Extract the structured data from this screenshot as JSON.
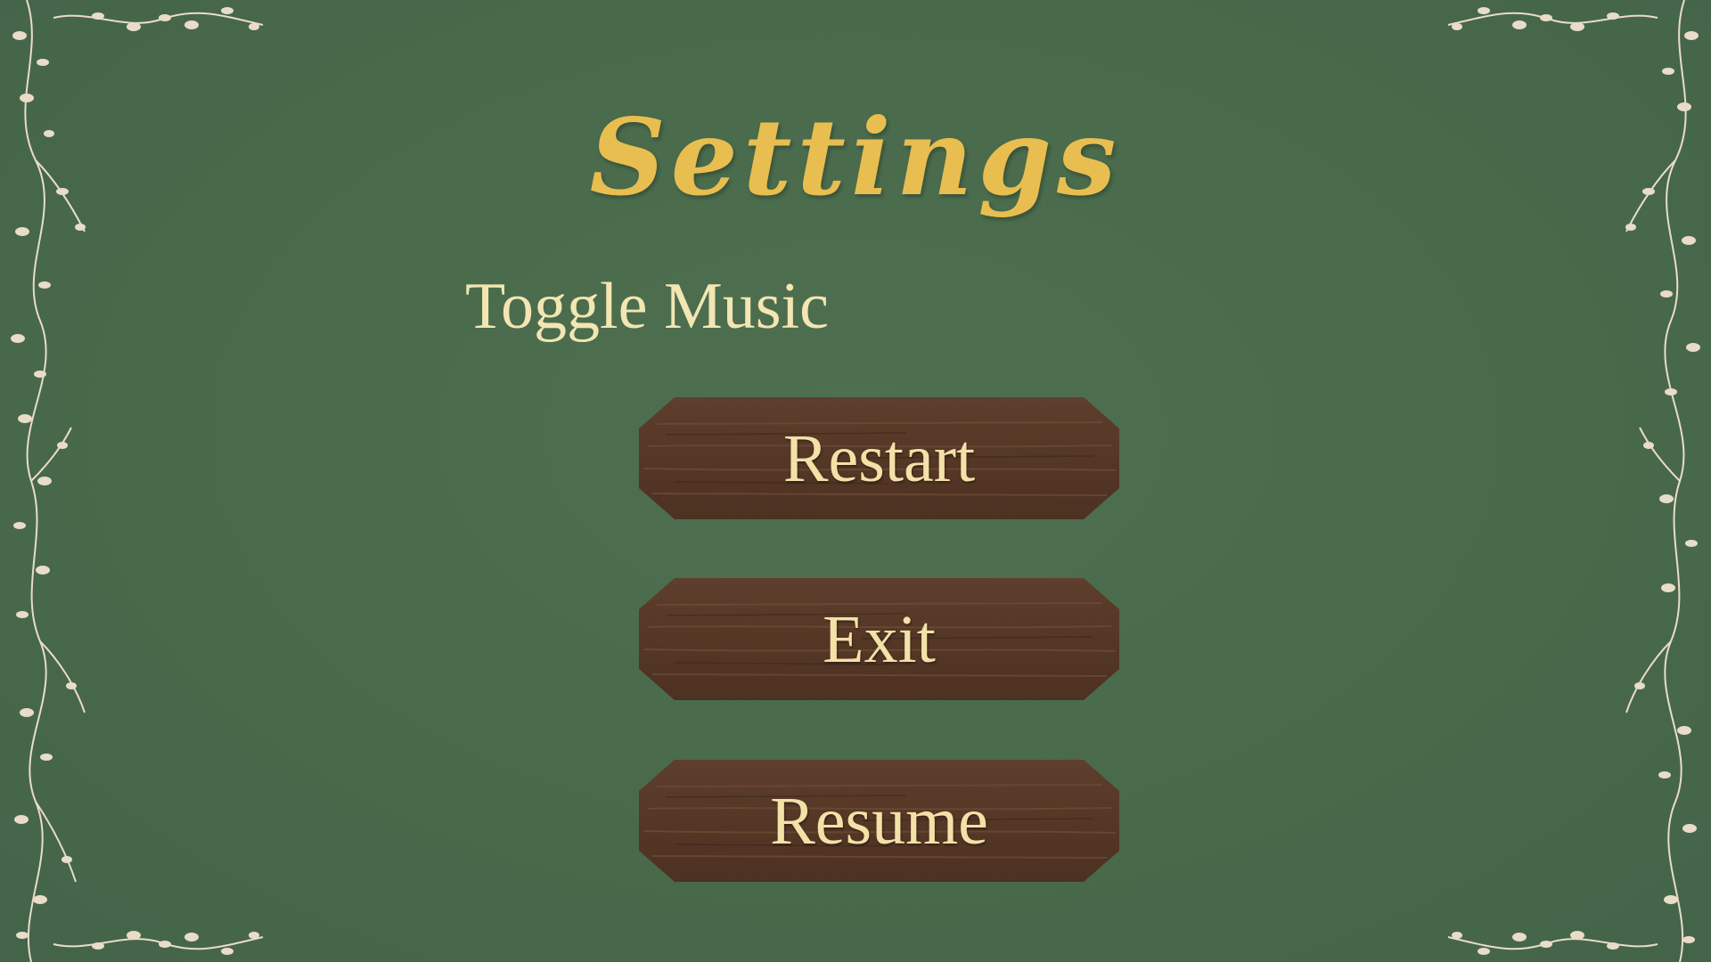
{
  "screen": {
    "title": "Settings",
    "background_color": "#48694a",
    "accent_color": "#e8be50",
    "text_color": "#f3e6b3"
  },
  "options": {
    "toggle_music_label": "Toggle Music"
  },
  "buttons": {
    "restart_label": "Restart",
    "exit_label": "Exit",
    "resume_label": "Resume",
    "plank_color": "#5a3b2a"
  },
  "decor": {
    "border_icon": "floral-vine-icon"
  }
}
